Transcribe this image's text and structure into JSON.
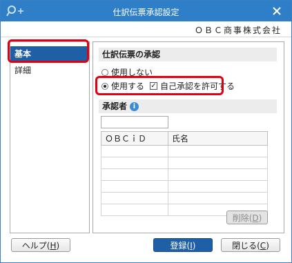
{
  "window": {
    "title": "仕訳伝票承認設定",
    "company": "ＯＢＣ商事株式会社"
  },
  "nav": {
    "items": [
      {
        "label": "基本"
      },
      {
        "label": "詳細"
      }
    ]
  },
  "approval": {
    "section_title": "仕訳伝票の承認",
    "radio_no": "使用しない",
    "radio_yes": "使用する",
    "self_approval_label": "自己承認を許可する",
    "self_approval_mark": "✓"
  },
  "approver": {
    "section_title": "承認者",
    "info_glyph": "i",
    "columns": [
      "ＯＢＣｉＤ",
      "氏名"
    ]
  },
  "buttons": {
    "delete_label": "削除(",
    "delete_key": "D",
    "delete_close": ")",
    "help_label": "ヘルプ(",
    "help_key": "H",
    "help_close": ")",
    "register_label": "登録(",
    "register_key": "I",
    "register_close": ")",
    "close_label": "閉じる(",
    "close_key": "C",
    "close_close": ")"
  }
}
